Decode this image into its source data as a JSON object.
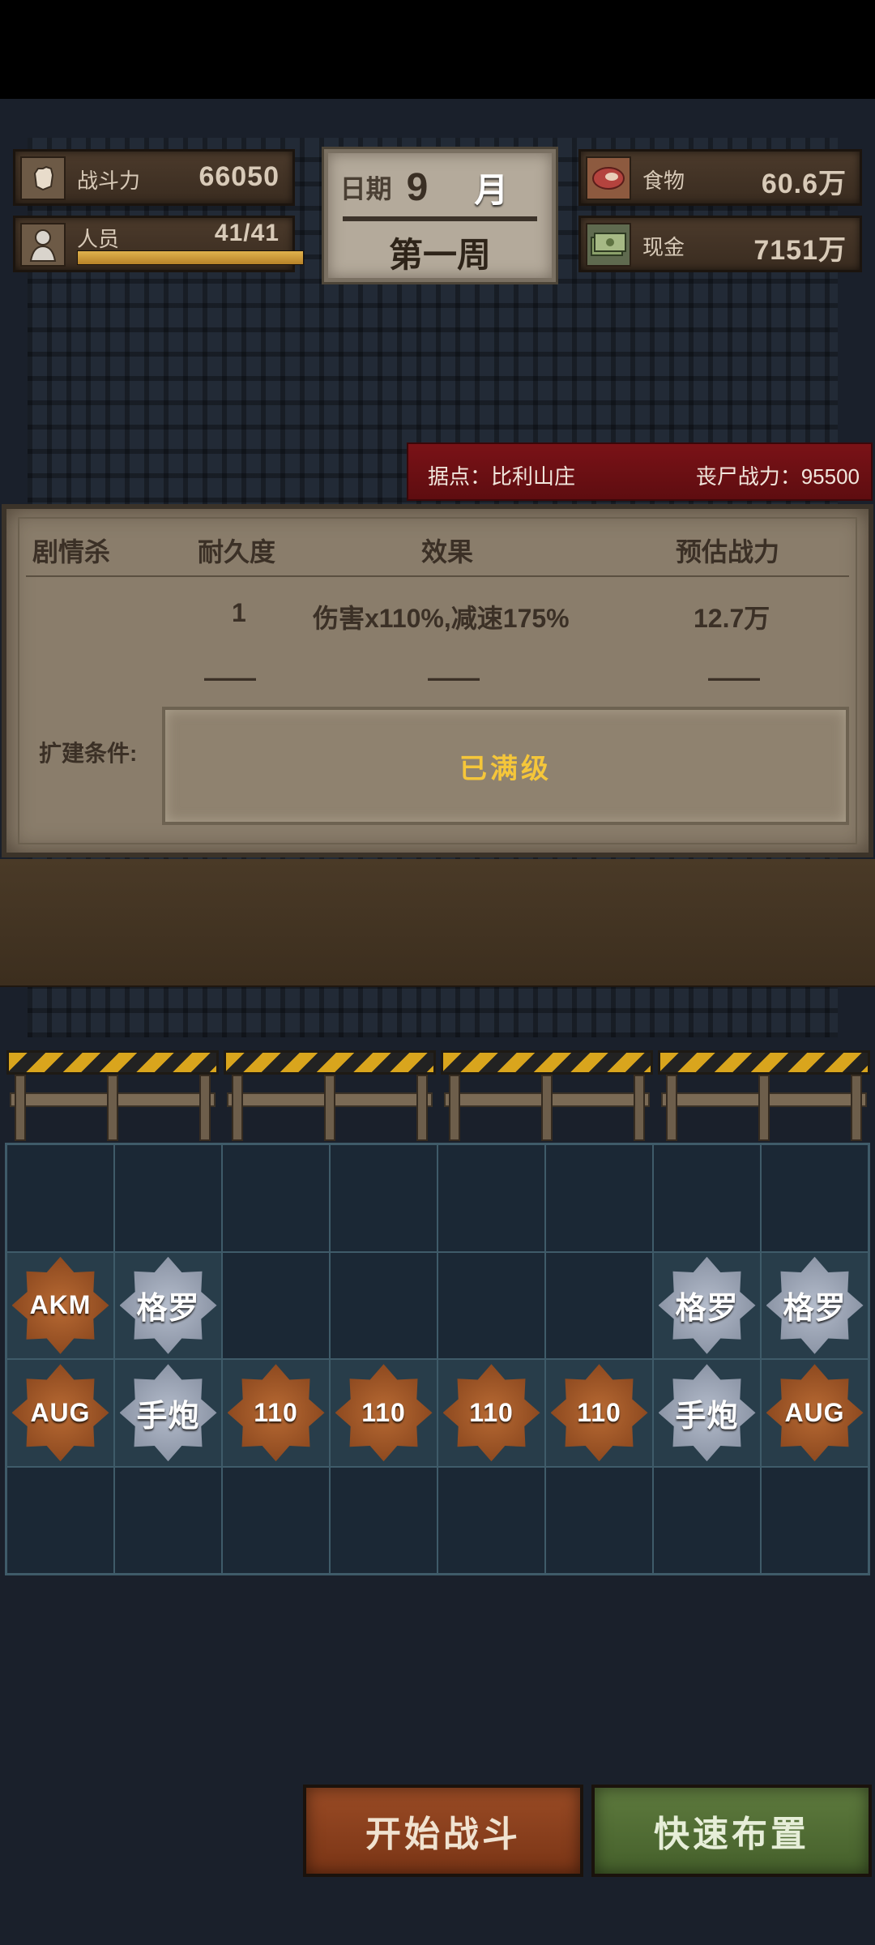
{
  "stats": {
    "combat": {
      "label": "战斗力",
      "value": "66050",
      "icon": "fist-icon"
    },
    "people": {
      "label": "人员",
      "value": "41/41",
      "icon": "person-icon",
      "fill": 1.0
    },
    "food": {
      "label": "食物",
      "value": "60.6万",
      "icon": "steak-icon"
    },
    "cash": {
      "label": "现金",
      "value": "7151万",
      "icon": "cash-icon"
    }
  },
  "date": {
    "label": "日期",
    "month": "9",
    "month_unit": "月",
    "week": "第一周"
  },
  "stronghold": {
    "name": "据点：比利山庄",
    "zombie_power": "丧尸战力：95500"
  },
  "panel": {
    "headers": [
      "剧情杀",
      "耐久度",
      "效果",
      "预估战力"
    ],
    "row1": {
      "durability": "1",
      "effect": "伤害x110%,减速175%",
      "power": "12.7万"
    },
    "row2": {
      "durability": "——",
      "effect": "——",
      "power": "——"
    },
    "expand_label": "扩建条件:",
    "expand_status": "已满级"
  },
  "grid": {
    "rows": [
      [
        null,
        null,
        null,
        null,
        null,
        null,
        null,
        null
      ],
      [
        {
          "label": "AKM",
          "style": "orange"
        },
        {
          "label": "格罗",
          "style": "silver"
        },
        null,
        null,
        null,
        null,
        {
          "label": "格罗",
          "style": "silver"
        },
        {
          "label": "格罗",
          "style": "silver"
        }
      ],
      [
        {
          "label": "AUG",
          "style": "orange"
        },
        {
          "label": "手炮",
          "style": "silver"
        },
        {
          "label": "110",
          "style": "orange"
        },
        {
          "label": "110",
          "style": "orange"
        },
        {
          "label": "110",
          "style": "orange"
        },
        {
          "label": "110",
          "style": "orange"
        },
        {
          "label": "手炮",
          "style": "silver"
        },
        {
          "label": "AUG",
          "style": "orange"
        }
      ],
      [
        null,
        null,
        null,
        null,
        null,
        null,
        null,
        null
      ]
    ]
  },
  "buttons": {
    "start": "开始战斗",
    "quick": "快速布置"
  },
  "colors": {
    "accent_gold": "#f5c63a",
    "stronghold_red": "#7a1217",
    "start_btn": "#9a4b25",
    "quick_btn": "#5e7a3e"
  }
}
